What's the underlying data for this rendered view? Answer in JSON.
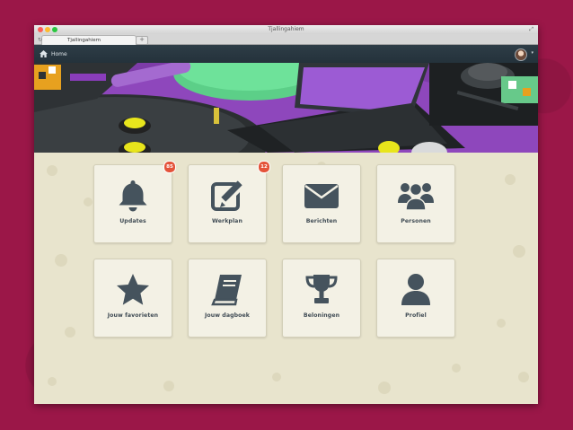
{
  "window": {
    "title": "Tjallingahiem"
  },
  "browser": {
    "tab_label": "Tjallingahiem",
    "new_tab": "+"
  },
  "nav": {
    "home_label": "Home",
    "avatar_caret": "▾"
  },
  "colors": {
    "navbar": "#2e3d47",
    "tile_icon": "#45535d",
    "badge": "#e4533a",
    "backdrop": "#9b1748"
  },
  "tiles": [
    {
      "label": "Updates",
      "icon": "bell-icon",
      "badge": "85"
    },
    {
      "label": "Werkplan",
      "icon": "edit-icon",
      "badge": "12"
    },
    {
      "label": "Berichten",
      "icon": "envelope-icon"
    },
    {
      "label": "Personen",
      "icon": "group-icon"
    },
    {
      "label": "Jouw favorieten",
      "icon": "star-icon"
    },
    {
      "label": "Jouw dagboek",
      "icon": "book-icon"
    },
    {
      "label": "Beloningen",
      "icon": "trophy-icon"
    },
    {
      "label": "Profiel",
      "icon": "person-icon"
    }
  ]
}
